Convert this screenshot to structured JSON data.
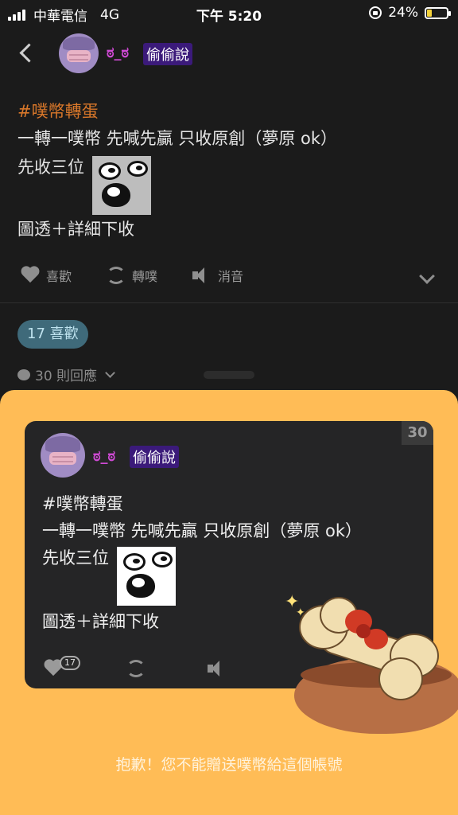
{
  "status_bar": {
    "carrier": "中華電信",
    "network": "4G",
    "time": "下午 5:20",
    "battery": "24%",
    "battery_level": 0.24,
    "battery_color": "#f5d33b"
  },
  "header": {
    "nickname": "ಠ_ಠ",
    "badge": "偷偷說"
  },
  "post": {
    "hashtag": "#噗幣轉蛋",
    "line1": "一轉一噗幣 先喊先贏 只收原創（夢原 ok）",
    "line2": "先收三位",
    "line3": "圖透＋詳細下收"
  },
  "actions": {
    "like": "喜歡",
    "replurk": "轉噗",
    "mute": "消音"
  },
  "likes_pill": "17 喜歡",
  "responses": "30 則回應",
  "gift_card": {
    "counter": "30",
    "nickname": "ಠ_ಠ",
    "badge": "偷偷說",
    "like_count": "17"
  },
  "sheet_message": "抱歉！您不能贈送噗幣給這個帳號",
  "colors": {
    "background": "#1b1b1b",
    "sheet": "#ffbc56",
    "hashtag": "#d8772a",
    "nickname": "#d14ad6",
    "badge": "#3b1a7a"
  }
}
